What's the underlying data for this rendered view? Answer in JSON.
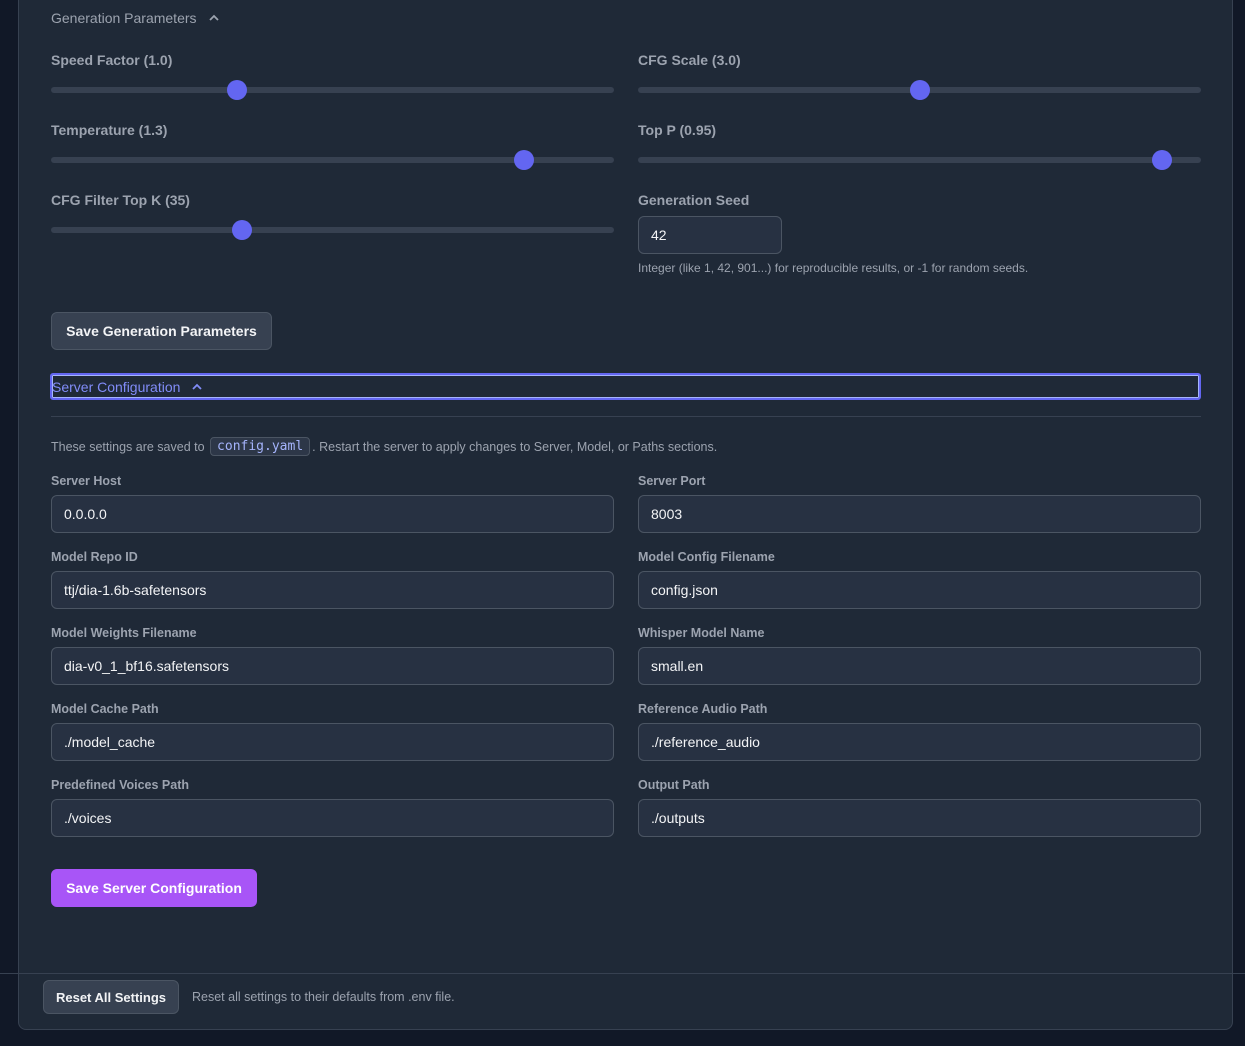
{
  "generation": {
    "title": "Generation Parameters",
    "sliders": [
      {
        "label": "Speed Factor (1.0)",
        "value": 0.33
      },
      {
        "label": "CFG Scale (3.0)",
        "value": 0.5
      },
      {
        "label": "Temperature (1.3)",
        "value": 0.84
      },
      {
        "label": "Top P (0.95)",
        "value": 0.93
      },
      {
        "label": "CFG Filter Top K (35)",
        "value": 0.34
      }
    ],
    "seed_label": "Generation Seed",
    "seed_value": "42",
    "seed_help": "Integer (like 1, 42, 901...) for reproducible results, or -1 for random seeds.",
    "save_button": "Save Generation Parameters"
  },
  "server": {
    "title": "Server Configuration",
    "note_before": "These settings are saved to",
    "note_code": "config.yaml",
    "note_after": ". Restart the server to apply changes to Server, Model, or Paths sections.",
    "fields": [
      {
        "label": "Server Host",
        "value": "0.0.0.0"
      },
      {
        "label": "Server Port",
        "value": "8003"
      },
      {
        "label": "Model Repo ID",
        "value": "ttj/dia-1.6b-safetensors"
      },
      {
        "label": "Model Config Filename",
        "value": "config.json"
      },
      {
        "label": "Model Weights Filename",
        "value": "dia-v0_1_bf16.safetensors"
      },
      {
        "label": "Whisper Model Name",
        "value": "small.en"
      },
      {
        "label": "Model Cache Path",
        "value": "./model_cache"
      },
      {
        "label": "Reference Audio Path",
        "value": "./reference_audio"
      },
      {
        "label": "Predefined Voices Path",
        "value": "./voices"
      },
      {
        "label": "Output Path",
        "value": "./outputs"
      }
    ],
    "save_button": "Save Server Configuration"
  },
  "footer": {
    "reset_button": "Reset All Settings",
    "reset_help": "Reset all settings to their defaults from .env file."
  },
  "colors": {
    "accent": "#6366f1",
    "primary_button": "#a855f7",
    "background": "#1f2937"
  }
}
